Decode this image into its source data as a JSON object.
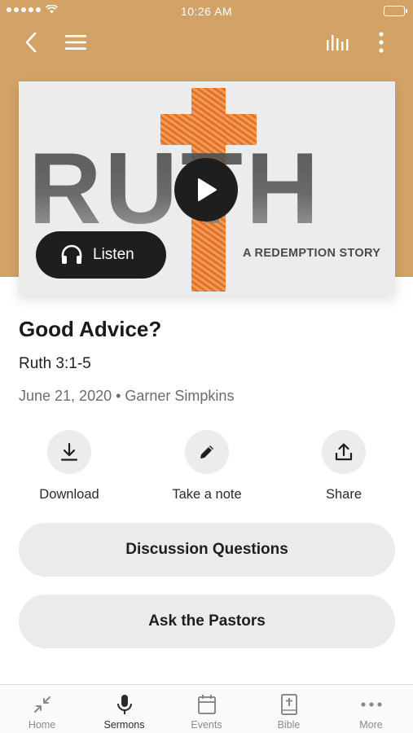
{
  "status_bar": {
    "time": "10:26 AM"
  },
  "nav": {
    "back_icon": "chevron-left-icon",
    "menu_icon": "hamburger-menu-icon",
    "audio_icon": "audio-bars-icon",
    "more_icon": "more-vertical-icon"
  },
  "hero": {
    "title": "RUTH",
    "subtitle": "A REDEMPTION STORY",
    "listen_label": "Listen",
    "accent_color": "#f08532"
  },
  "sermon": {
    "title": "Good Advice?",
    "scripture": "Ruth 3:1-5",
    "meta": "June 21, 2020 • Garner Simpkins"
  },
  "actions": [
    {
      "label": "Download",
      "icon": "download-icon"
    },
    {
      "label": "Take a note",
      "icon": "pencil-icon"
    },
    {
      "label": "Share",
      "icon": "share-icon"
    }
  ],
  "buttons": {
    "discussion": "Discussion Questions",
    "ask_pastors": "Ask the Pastors"
  },
  "tabs": [
    {
      "label": "Home",
      "icon": "home-compress-icon",
      "active": false
    },
    {
      "label": "Sermons",
      "icon": "microphone-icon",
      "active": true
    },
    {
      "label": "Events",
      "icon": "calendar-icon",
      "active": false
    },
    {
      "label": "Bible",
      "icon": "bible-icon",
      "active": false
    },
    {
      "label": "More",
      "icon": "more-horizontal-icon",
      "active": false
    }
  ],
  "colors": {
    "header": "#d3a266",
    "active_tab": "#2b2b2b",
    "inactive_tab": "#8a8a8a"
  }
}
